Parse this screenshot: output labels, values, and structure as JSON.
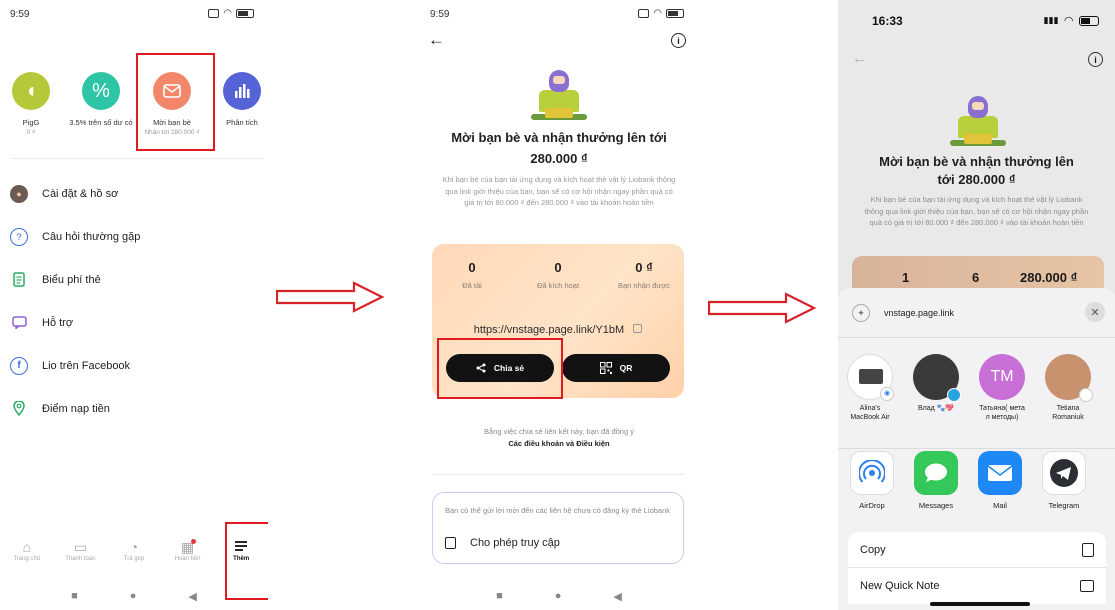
{
  "phone1": {
    "status": {
      "time": "9:59"
    },
    "quick_actions": [
      {
        "label": "PigG",
        "sub": "0 ₫",
        "color": "#b5c83a"
      },
      {
        "label": "3.5% trên số dư có",
        "sub": "",
        "color": "#2ec4a6"
      },
      {
        "label": "Mời bạn bè",
        "sub": "Nhận tới 280.000 ₫",
        "color": "#f2876a"
      },
      {
        "label": "Phân tích",
        "sub": "",
        "color": "#5663d6"
      }
    ],
    "menu": [
      {
        "label": "Cài đặt & hồ sơ",
        "icon": "avatar-icon"
      },
      {
        "label": "Câu hỏi thường gặp",
        "icon": "help-icon"
      },
      {
        "label": "Biểu phí thẻ",
        "icon": "document-icon"
      },
      {
        "label": "Hỗ trợ",
        "icon": "chat-icon"
      },
      {
        "label": "Lio trên Facebook",
        "icon": "facebook-icon"
      },
      {
        "label": "Điểm nạp tiền",
        "icon": "location-icon"
      }
    ],
    "tabs": [
      {
        "label": "Trang chủ"
      },
      {
        "label": "Thanh toán"
      },
      {
        "label": "Trả góp"
      },
      {
        "label": "Hoàn tiền"
      },
      {
        "label": "Thêm"
      }
    ]
  },
  "phone2": {
    "status": {
      "time": "9:59"
    },
    "title_line1": "Mời bạn bè và nhận thưởng lên tới",
    "title_line2": "280.000 ₫",
    "description": "Khi bạn bè của bạn tải ứng dụng và kích hoạt thẻ vật lý Liobank thông qua link giới thiệu của bạn, bạn sẽ có cơ hội nhận ngay phần quà có giá trị tới 80.000 ₫ đến 280.000 ₫ vào tài khoản hoàn tiền",
    "stats": [
      {
        "value": "0",
        "label": "Đã tải"
      },
      {
        "value": "0",
        "label": "Đã kích hoạt"
      },
      {
        "value": "0 ₫",
        "label": "Bạn nhận được"
      }
    ],
    "link": "https://vnstage.page.link/Y1bM",
    "share_label": "Chia sẻ",
    "qr_label": "QR",
    "terms_line1": "Bằng việc chia sẻ liên kết này, bạn đã đồng ý",
    "terms_line2": "Các điều khoản và Điều kiện",
    "permission_text": "Bạn có thể gửi lời mời đến các liên hệ chưa có đăng ký thẻ Liobank",
    "permission_action": "Cho phép truy cập"
  },
  "phone3": {
    "status": {
      "time": "16:33"
    },
    "title_line1": "Mời bạn bè và nhận thưởng lên",
    "title_line2": "tới 280.000 ₫",
    "description": "Khi bạn bè của bạn tải ứng dụng và kích hoạt thẻ vật lý Liobank thông qua link giới thiệu của bạn, bạn sẽ có cơ hội nhận ngay phần quà có giá trị tới 80.000 ₫ đến 280.000 ₫ vào tài khoản hoàn tiền",
    "stats": [
      "1",
      "6",
      "280.000 ₫"
    ],
    "share_sheet": {
      "url": "vnstage.page.link",
      "people": [
        {
          "name_line1": "Alina's",
          "name_line2": "MacBook Air",
          "color": "#d9dde3",
          "initials": ""
        },
        {
          "name_line1": "Влад 🐾💖",
          "name_line2": "",
          "color": "#3a3a3a",
          "initials": ""
        },
        {
          "name_line1": "Татьяна( мета",
          "name_line2": "л методы)",
          "color": "#c86fd6",
          "initials": "TM"
        },
        {
          "name_line1": "Tetiana",
          "name_line2": "Romaniuk",
          "color": "#c9926f",
          "initials": ""
        }
      ],
      "apps": [
        {
          "label": "AirDrop",
          "color": "#ffffff",
          "icon": "airdrop-icon"
        },
        {
          "label": "Messages",
          "color": "#34c759",
          "icon": "messages-icon"
        },
        {
          "label": "Mail",
          "color": "#1e88f5",
          "icon": "mail-icon"
        },
        {
          "label": "Telegram",
          "color": "#ffffff",
          "icon": "telegram-icon"
        }
      ],
      "actions": [
        {
          "label": "Copy",
          "icon": "copy-icon"
        },
        {
          "label": "New Quick Note",
          "icon": "quick-note-icon"
        }
      ]
    }
  }
}
